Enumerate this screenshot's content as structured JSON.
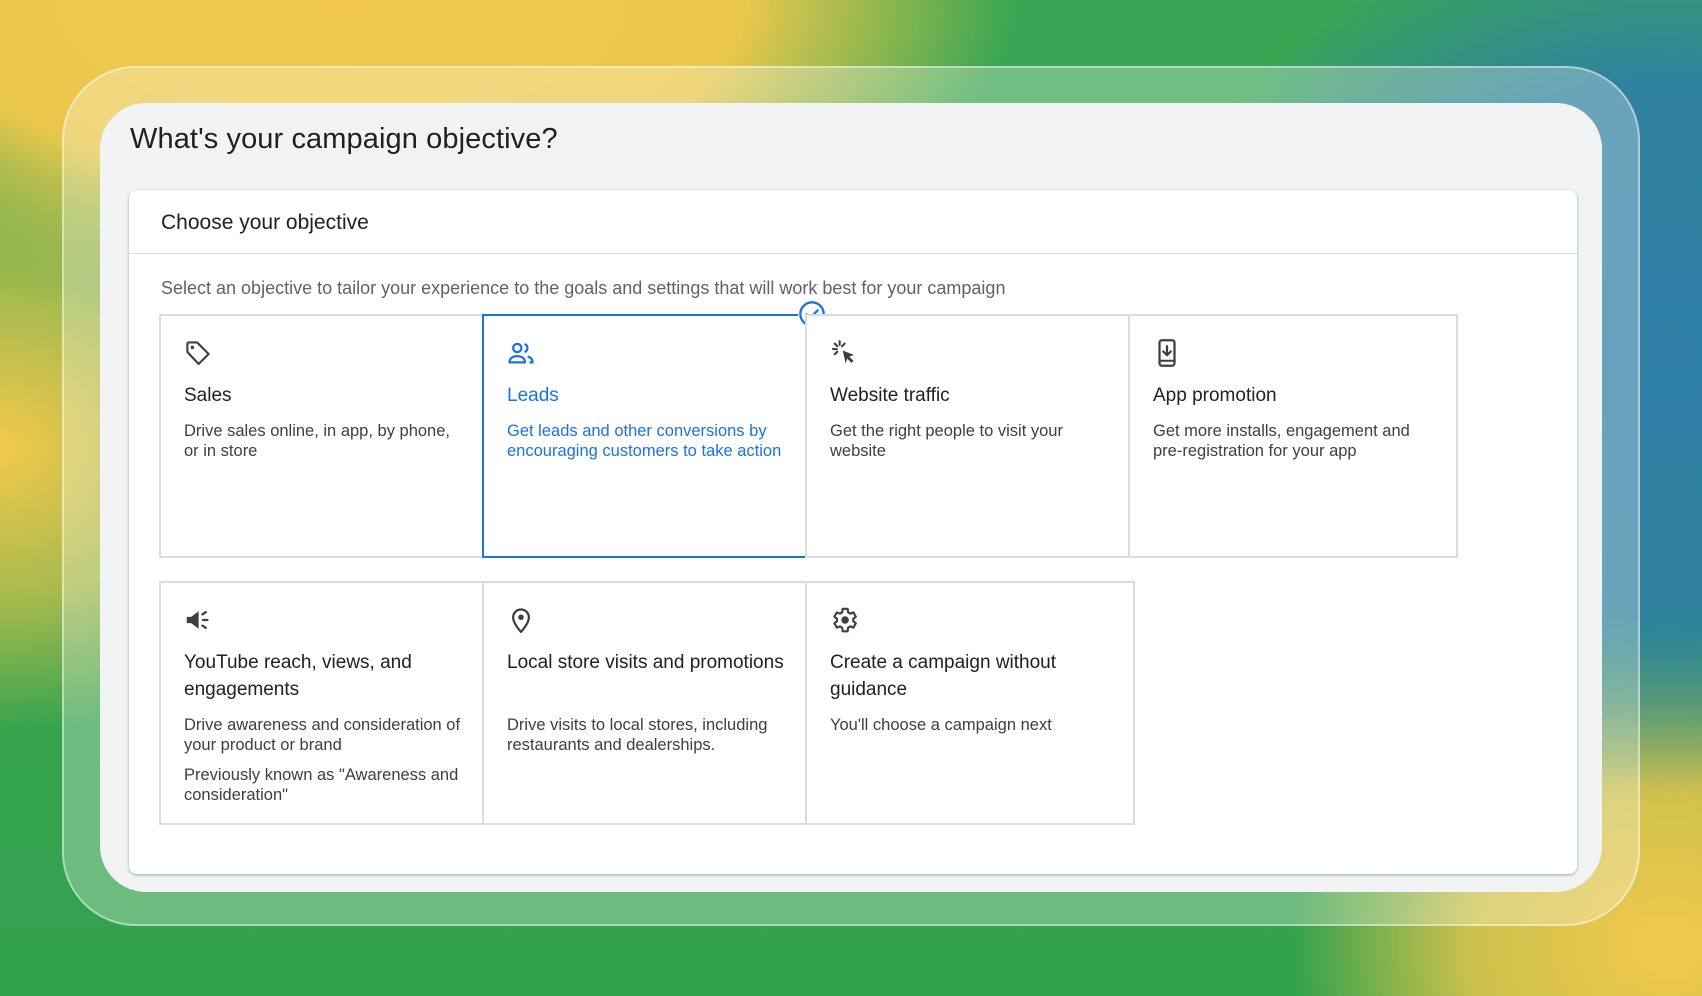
{
  "page": {
    "title": "What's your campaign objective?"
  },
  "panel": {
    "title": "Choose your objective",
    "subtitle": "Select an objective to tailor your experience to the goals and settings that will work best for your campaign"
  },
  "objectives": [
    {
      "icon": "tag-icon",
      "title": "Sales",
      "description": "Drive sales online, in app, by phone, or in store",
      "selected": false
    },
    {
      "icon": "people-icon",
      "title": "Leads",
      "description": "Get leads and other conversions by encouraging customers to take action",
      "selected": true
    },
    {
      "icon": "cursor-click-icon",
      "title": "Website traffic",
      "description": "Get the right people to visit your website",
      "selected": false
    },
    {
      "icon": "phone-download-icon",
      "title": "App promotion",
      "description": "Get more installs, engagement and pre-registration for your app",
      "selected": false
    },
    {
      "icon": "megaphone-icon",
      "title": "YouTube reach, views, and engagements",
      "description": "Drive awareness and consideration of your product or brand",
      "note": "Previously known as \"Awareness and consideration\"",
      "selected": false
    },
    {
      "icon": "location-pin-icon",
      "title": "Local store visits and promotions",
      "description": "Drive visits to local stores, including restaurants and dealerships.",
      "selected": false
    },
    {
      "icon": "gear-icon",
      "title": "Create a campaign without guidance",
      "description": "You'll choose a campaign next",
      "selected": false
    }
  ],
  "colors": {
    "accent": "#1a73e8",
    "border": "#dadce0",
    "text": "#202124",
    "secondary_text": "#3c4043",
    "panel_background": "#f1f3f4"
  }
}
